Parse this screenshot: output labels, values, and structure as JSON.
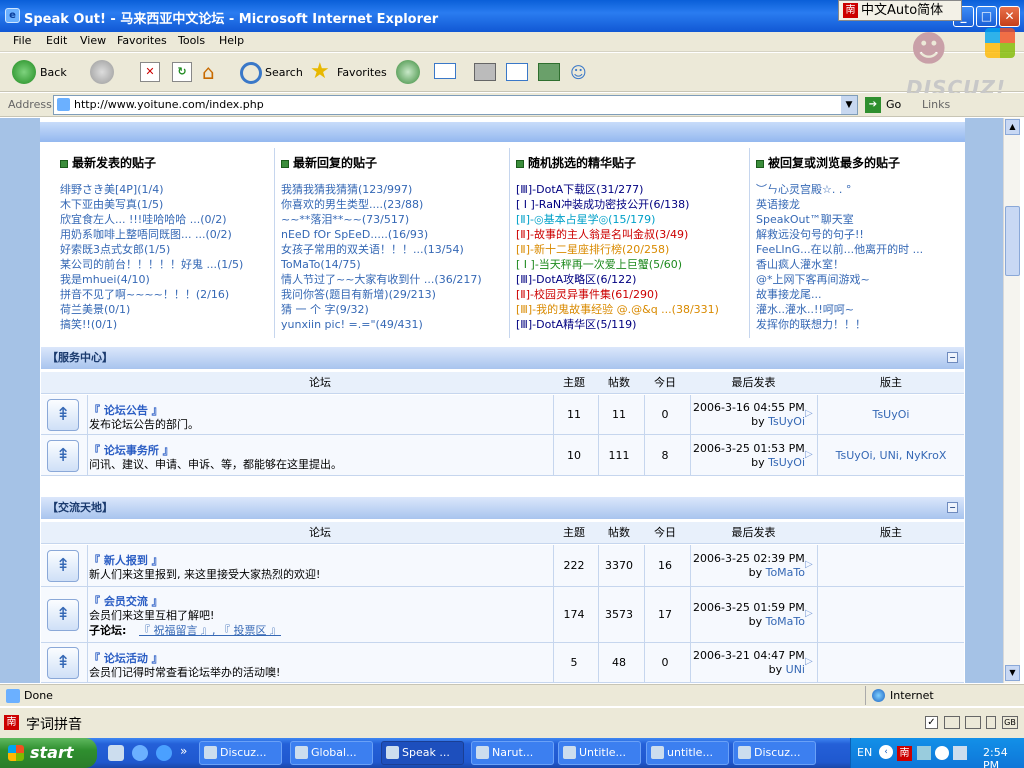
{
  "window": {
    "title": "Speak Out! - 马来西亚中文论坛 - Microsoft Internet Explorer",
    "ime_float": "中文Auto简体",
    "min": "_",
    "max": "□",
    "close": "✕"
  },
  "menu": [
    "File",
    "Edit",
    "View",
    "Favorites",
    "Tools",
    "Help"
  ],
  "toolbar": {
    "back": "Back",
    "search": "Search",
    "favorites": "Favorites"
  },
  "logo_text": "DISCUZ!",
  "address": {
    "label": "Address",
    "url": "http://www.yoitune.com/index.php",
    "go": "Go",
    "links": "Links"
  },
  "columns": [
    {
      "title": "最新发表的贴子",
      "items": [
        "绯野さき美[4P](1/4)",
        "木下亚由美写真(1/5)",
        "欣宜食左人... !!!哇哈哈哈 ...(0/2)",
        "用奶系咖啡上整唔同既图... ...(0/2)",
        "好索既3点式女郎(1/5)",
        "某公司的前台！！！！！好鬼 ...(1/5)",
        "我是mhuei(4/10)",
        "拼音不见了啊~~~~！！！(2/16)",
        "荷兰美景(0/1)",
        "搞笑!!(0/1)"
      ]
    },
    {
      "title": "最新回复的贴子",
      "items": [
        "我猜我猜我猜猜(123/997)",
        "你喜欢的男生类型....(23/88)",
        "~~**落泪**~~(73/517)",
        "nEeD fOr SpEeD.....(16/93)",
        "女孩子常用的双关语！！！...(13/54)",
        "ToMaTo(14/75)",
        "情人节过了~~大家有收到什 ...(36/217)",
        "我问你答(题目有新增)(29/213)",
        "猜 一 个 字(9/32)",
        "yunxiin pic! =.=\"(49/431)"
      ]
    },
    {
      "title": "随机挑选的精华贴子",
      "items": [
        "[Ⅲ]-DotA下载区(31/277)",
        "[ I ]-RaN冲装成功密技公开(6/138)",
        "[Ⅱ]-◎基本占星学◎(15/179)",
        "[Ⅱ]-故事的主人翁是名叫金叔(3/49)",
        "[Ⅱ]-新十二星座排行榜(20/258)",
        "[ I ]-当天秤再一次爱上巨蟹(5/60)",
        "[Ⅲ]-DotA攻略区(6/122)",
        "[Ⅱ]-校园灵异事件集(61/290)",
        "[Ⅲ]-我的鬼故事经验 @.@&q ...(38/331)",
        "[Ⅲ]-DotA精华区(5/119)"
      ]
    },
    {
      "title": "被回复或浏览最多的贴子",
      "items": [
        "︶ㄣ心灵宫殿☆. . °",
        "英语接龙",
        "SpeakOut™聊天室",
        "解救远没句号的句子!!",
        "FeeLInG...在以前...他离开的时 ...",
        "香山疯人灌水室！",
        "@*上网下客再间游戏~",
        "故事接龙尾...",
        "灌水..灌水..!!呵呵~",
        "发挥你的联想力！！！"
      ]
    }
  ],
  "headers": {
    "forum": "论坛",
    "topics": "主题",
    "posts": "帖数",
    "today": "今日",
    "last": "最后发表",
    "mods": "版主"
  },
  "categories": [
    {
      "name": "【服务中心】",
      "forums": [
        {
          "name": "『 论坛公告 』",
          "desc": "发布论坛公告的部门。",
          "topics": "11",
          "posts": "11",
          "today": "0",
          "last_time": "2006-3-16 04:55 PM",
          "last_by_label": "by",
          "last_by": "TsUyOi",
          "mods": "TsUyOi"
        },
        {
          "name": "『 论坛事务所 』",
          "desc": "问讯、建议、申请、申诉、等，都能够在这里提出。",
          "topics": "10",
          "posts": "111",
          "today": "8",
          "last_time": "2006-3-25 01:53 PM",
          "last_by_label": "by",
          "last_by": "TsUyOi",
          "mods": "TsUyOi, UNi, NyKroX"
        }
      ]
    },
    {
      "name": "【交流天地】",
      "forums": [
        {
          "name": "『 新人报到 』",
          "desc": "新人们来这里报到, 来这里接受大家热烈的欢迎!",
          "topics": "222",
          "posts": "3370",
          "today": "16",
          "last_time": "2006-3-25 02:39 PM",
          "last_by_label": "by",
          "last_by": "ToMaTo",
          "mods": ""
        },
        {
          "name": "『 会员交流 』",
          "desc": "会员们来这里互相了解吧!",
          "sub_label": "子论坛:",
          "sub": "『 祝福留言 』, 『 投票区 』",
          "topics": "174",
          "posts": "3573",
          "today": "17",
          "last_time": "2006-3-25 01:59 PM",
          "last_by_label": "by",
          "last_by": "ToMaTo",
          "mods": ""
        },
        {
          "name": "『 论坛活动 』",
          "desc": "会员们记得时常查看论坛举办的活动噢!",
          "topics": "5",
          "posts": "48",
          "today": "0",
          "last_time": "2006-3-21 04:47 PM",
          "last_by_label": "by",
          "last_by": "UNi",
          "mods": ""
        }
      ]
    }
  ],
  "status": {
    "text": "Done",
    "zone": "Internet"
  },
  "ime_bar": "字词拼音",
  "taskbar": {
    "start": "start",
    "tasks": [
      "Discuz...",
      "Global...",
      "Speak ...",
      "Narut...",
      "Untitle...",
      "untitle...",
      "Discuz..."
    ],
    "lang": "EN",
    "clock": "2:54 PM"
  },
  "colors": {
    "link": "#3568b5",
    "red": "#cc0000",
    "orange": "#d98a00",
    "green": "#1f8a1f",
    "cyan": "#00a0c8",
    "dark": "#000080"
  }
}
